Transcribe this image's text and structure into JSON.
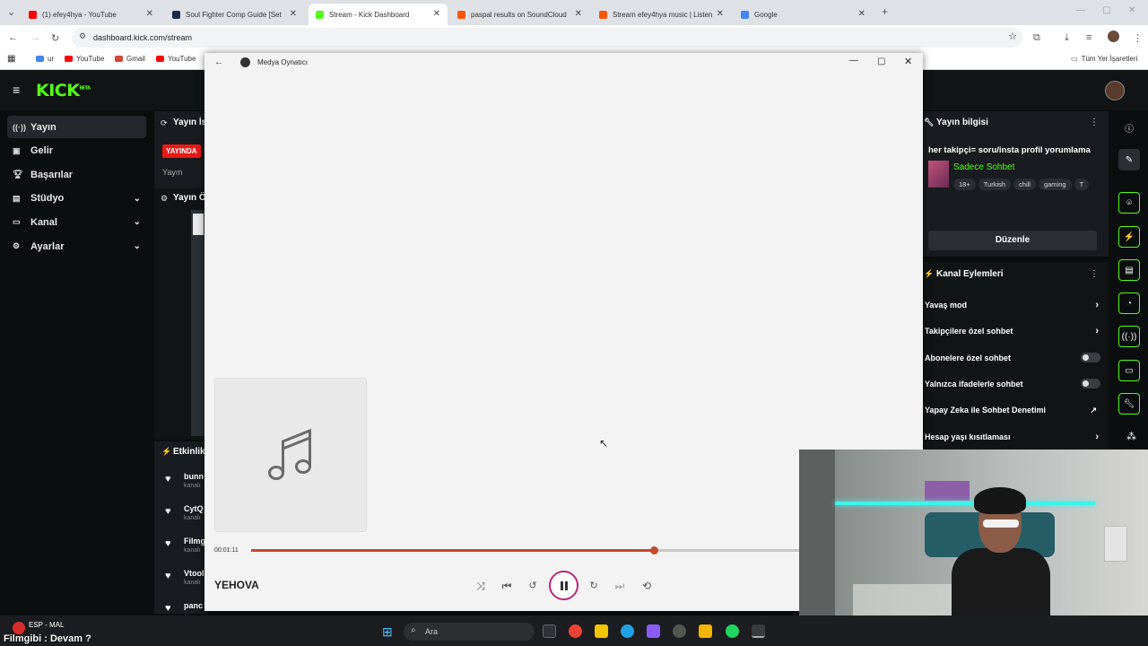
{
  "browser": {
    "tabs": [
      {
        "title": "(1) efey4hya - YouTube",
        "color": "#ff0000",
        "active": false
      },
      {
        "title": "Soul Fighter Comp Guide [Set",
        "color": "#1a2b4c",
        "active": false
      },
      {
        "title": "Stream - Kick Dashboard",
        "color": "#53fc18",
        "active": true
      },
      {
        "title": "paspal results on SoundCloud",
        "color": "#ff5500",
        "active": false
      },
      {
        "title": "Stream efey4hya music | Listen",
        "color": "#ff5500",
        "active": false
      },
      {
        "title": "Google",
        "color": "#4285f4",
        "active": false
      }
    ],
    "url": "dashboard.kick.com/stream",
    "bookmarks": [
      {
        "label": "ur",
        "icon": "google-icon"
      },
      {
        "label": "YouTube",
        "icon": "youtube-icon"
      },
      {
        "label": "Gmail",
        "icon": "gmail-icon"
      },
      {
        "label": "YouTube",
        "icon": "youtube-icon"
      }
    ],
    "all_bookmarks": "Tüm Yer İşaretleri"
  },
  "kick": {
    "nav": [
      {
        "label": "Yayın",
        "icon": "broadcast-icon",
        "selected": true,
        "expandable": false
      },
      {
        "label": "Gelir",
        "icon": "revenue-icon",
        "selected": false,
        "expandable": false
      },
      {
        "label": "Başarılar",
        "icon": "trophy-icon",
        "selected": false,
        "expandable": false
      },
      {
        "label": "Stüdyo",
        "icon": "studio-icon",
        "selected": false,
        "expandable": true
      },
      {
        "label": "Kanal",
        "icon": "channel-icon",
        "selected": false,
        "expandable": true
      },
      {
        "label": "Ayarlar",
        "icon": "gear-icon",
        "selected": false,
        "expandable": true
      }
    ],
    "mid": {
      "info_title": "Yayın İs",
      "live_badge": "YAYINDA",
      "yayin_label": "Yayın",
      "preview_title": "Yayın Ö",
      "activity_title": "Etkinlik",
      "activity": [
        {
          "name": "bunn",
          "sub": "kanalı"
        },
        {
          "name": "CytQ",
          "sub": "kanalı"
        },
        {
          "name": "Filmg",
          "sub": "kanalı"
        },
        {
          "name": "Vtool",
          "sub": "kanalı"
        },
        {
          "name": "panc",
          "sub": ""
        }
      ]
    },
    "stream_info": {
      "header": "Yayın bilgisi",
      "title": "her takipçi= soru/insta profil yorumlama",
      "category": "Sadece Sohbet",
      "tags": [
        "18+",
        "Turkish",
        "chill",
        "gaming",
        "T"
      ],
      "edit_button": "Düzenle"
    },
    "channel_actions": {
      "header": "Kanal Eylemleri",
      "items": [
        {
          "label": "Yavaş mod",
          "control": "chevron"
        },
        {
          "label": "Takipçilere özel sohbet",
          "control": "chevron"
        },
        {
          "label": "Abonelere özel sohbet",
          "control": "toggle"
        },
        {
          "label": "Yalnızca ifadelerle sohbet",
          "control": "toggle"
        },
        {
          "label": "Yapay Zeka ile Sohbet Denetimi",
          "control": "external"
        },
        {
          "label": "Hesap yaşı kısıtlaması",
          "control": "chevron"
        }
      ]
    },
    "accent": "#53fc18"
  },
  "player": {
    "window_title": "Medya Oynatıcı",
    "time_current": "00:01:11",
    "progress": 0.735,
    "track_title": "YEHOVA",
    "accent": "#c44a2b"
  },
  "taskbar": {
    "search_placeholder": "Ara",
    "weather_line1": "ESP - MAL",
    "weather_line2": "Filmgibi : Devam ?"
  }
}
